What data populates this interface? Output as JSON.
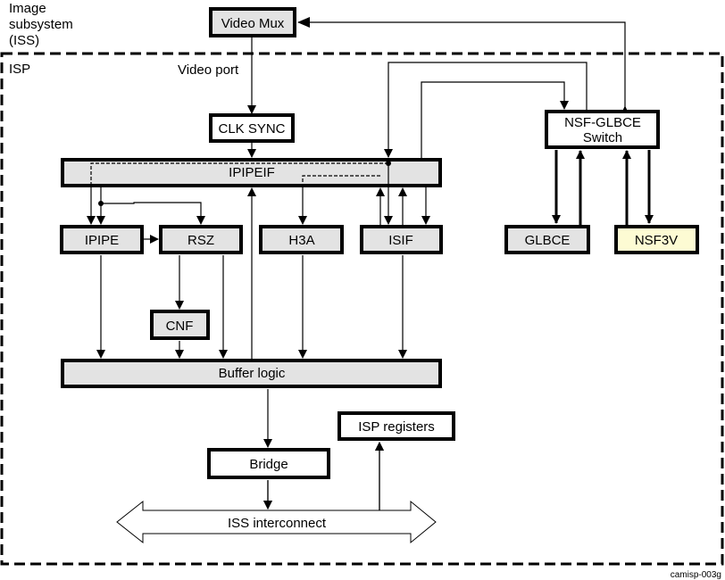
{
  "labels": {
    "iss_title": [
      "Image",
      "subsystem",
      "(ISS)"
    ],
    "isp_title": "ISP",
    "video_port": "Video port",
    "figure_id": "camisp-003g"
  },
  "blocks": {
    "video_mux": "Video Mux",
    "clk_sync": "CLK SYNC",
    "ipipeif": "IPIPEIF",
    "ipipe": "IPIPE",
    "rsz": "RSZ",
    "h3a": "H3A",
    "isif": "ISIF",
    "cnf": "CNF",
    "buffer_logic": "Buffer logic",
    "bridge": "Bridge",
    "isp_registers": "ISP registers",
    "iss_interconnect": "ISS interconnect",
    "nsf_glbce_switch": [
      "NSF-GLBCE",
      "Switch"
    ],
    "glbce": "GLBCE",
    "nsf3v": "NSF3V"
  },
  "colors": {
    "gray_block": "#e3e3e3",
    "white_block": "#ffffff",
    "yellow_block": "#fdfbd3",
    "line": "#000000"
  },
  "connections": [
    {
      "from": "NSF-GLBCE Switch",
      "to": "Video Mux",
      "bidirectional": true
    },
    {
      "from": "Video Mux",
      "to": "CLK SYNC",
      "label": "Video port"
    },
    {
      "from": "CLK SYNC",
      "to": "IPIPEIF"
    },
    {
      "from": "NSF-GLBCE Switch",
      "to": "IPIPEIF"
    },
    {
      "from": "ISIF",
      "to": "NSF-GLBCE Switch"
    },
    {
      "from": "IPIPEIF",
      "to": "IPIPE"
    },
    {
      "from": "IPIPEIF",
      "to": "RSZ"
    },
    {
      "from": "IPIPE",
      "to": "RSZ"
    },
    {
      "from": "IPIPEIF",
      "to": "H3A",
      "style": "dashed"
    },
    {
      "from": "IPIPEIF",
      "to": "ISIF"
    },
    {
      "from": "ISIF",
      "to": "IPIPEIF"
    },
    {
      "from": "RSZ",
      "to": "CNF"
    },
    {
      "from": "CNF",
      "to": "Buffer logic"
    },
    {
      "from": "IPIPE",
      "to": "Buffer logic"
    },
    {
      "from": "RSZ",
      "to": "Buffer logic"
    },
    {
      "from": "H3A",
      "to": "Buffer logic"
    },
    {
      "from": "ISIF",
      "to": "Buffer logic"
    },
    {
      "from": "Buffer logic",
      "to": "IPIPEIF"
    },
    {
      "from": "Buffer logic",
      "to": "Bridge"
    },
    {
      "from": "Bridge",
      "to": "ISS interconnect"
    },
    {
      "from": "ISS interconnect",
      "to": "ISP registers"
    },
    {
      "from": "NSF-GLBCE Switch",
      "to": "GLBCE"
    },
    {
      "from": "GLBCE",
      "to": "NSF-GLBCE Switch"
    },
    {
      "from": "NSF-GLBCE Switch",
      "to": "NSF3V"
    },
    {
      "from": "NSF3V",
      "to": "NSF-GLBCE Switch"
    }
  ]
}
